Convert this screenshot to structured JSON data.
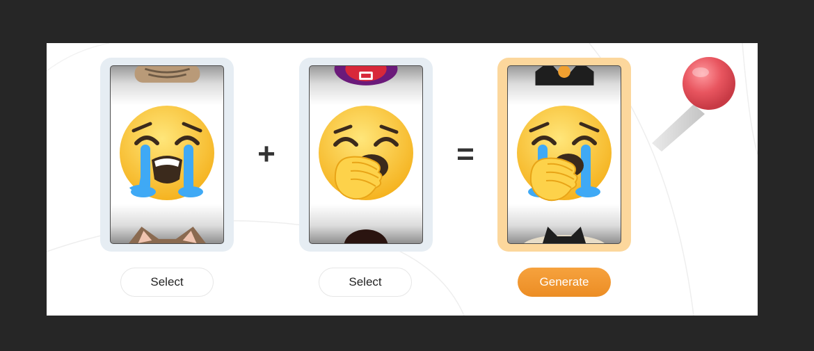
{
  "slots": [
    {
      "name": "first",
      "emoji_main": "loudly-crying-face",
      "peek_top": "tabby-cat",
      "peek_bottom": "tabby-cat-ears",
      "highlighted": false
    },
    {
      "name": "second",
      "emoji_main": "yawning-face",
      "peek_top": "red-circle-emoji",
      "peek_bottom": "dark-round-emoji",
      "highlighted": false
    },
    {
      "name": "result",
      "emoji_main": "crying-yawning-face",
      "peek_top": "black-cat-witch",
      "peek_bottom": "black-cat",
      "highlighted": true
    }
  ],
  "operators": {
    "plus": "+",
    "equals": "="
  },
  "buttons": {
    "select_1": "Select",
    "select_2": "Select",
    "generate": "Generate"
  },
  "colors": {
    "accent": "#ec8d24",
    "result_frame": "#fcd79c",
    "slot_frame": "#e6edf3",
    "lever_knob": "#e8555f"
  }
}
